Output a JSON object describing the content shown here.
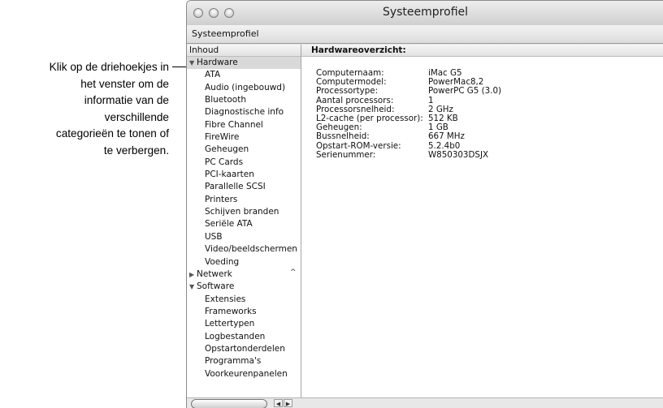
{
  "annotation": {
    "callout_lines": [
      "Klik op de driehoekjes in",
      "het venster om de",
      "informatie van de",
      "verschillende",
      "categorieën te tonen of",
      "te verbergen."
    ]
  },
  "window": {
    "title": "Systeemprofiel",
    "menu_item": "Systeemprofiel"
  },
  "sidebar": {
    "header": "Inhoud",
    "hardware": {
      "label": "Hardware",
      "expanded": true,
      "items": [
        "ATA",
        "Audio (ingebouwd)",
        "Bluetooth",
        "Diagnostische info",
        "Fibre Channel",
        "FireWire",
        "Geheugen",
        "PC Cards",
        "PCI-kaarten",
        "Parallelle SCSI",
        "Printers",
        "Schijven branden",
        "Seriële ATA",
        "USB",
        "Video/beeldschermen",
        "Voeding"
      ]
    },
    "netwerk": {
      "label": "Netwerk",
      "expanded": false
    },
    "software": {
      "label": "Software",
      "expanded": true,
      "items": [
        "Extensies",
        "Frameworks",
        "Lettertypen",
        "Logbestanden",
        "Opstartonderdelen",
        "Programma's",
        "Voorkeurenpanelen"
      ]
    }
  },
  "main": {
    "header": "Hardwareoverzicht:",
    "rows": [
      {
        "label": "Computernaam:",
        "value": "iMac G5"
      },
      {
        "label": "Computermodel:",
        "value": "PowerMac8,2"
      },
      {
        "label": "Processortype:",
        "value": "PowerPC G5 (3.0)"
      },
      {
        "label": "Aantal processors:",
        "value": "1"
      },
      {
        "label": "Processorsnelheid:",
        "value": "2 GHz"
      },
      {
        "label": "L2-cache (per processor):",
        "value": "512 KB"
      },
      {
        "label": "Geheugen:",
        "value": "1 GB"
      },
      {
        "label": "Bussnelheid:",
        "value": "667 MHz"
      },
      {
        "label": "Opstart-ROM-versie:",
        "value": "5.2.4b0"
      },
      {
        "label": "Serienummer:",
        "value": "W850303DSJX"
      }
    ]
  },
  "icons": {
    "expanded": "▼",
    "collapsed": "▶",
    "left": "◀",
    "right": "▶",
    "caret": "^"
  }
}
